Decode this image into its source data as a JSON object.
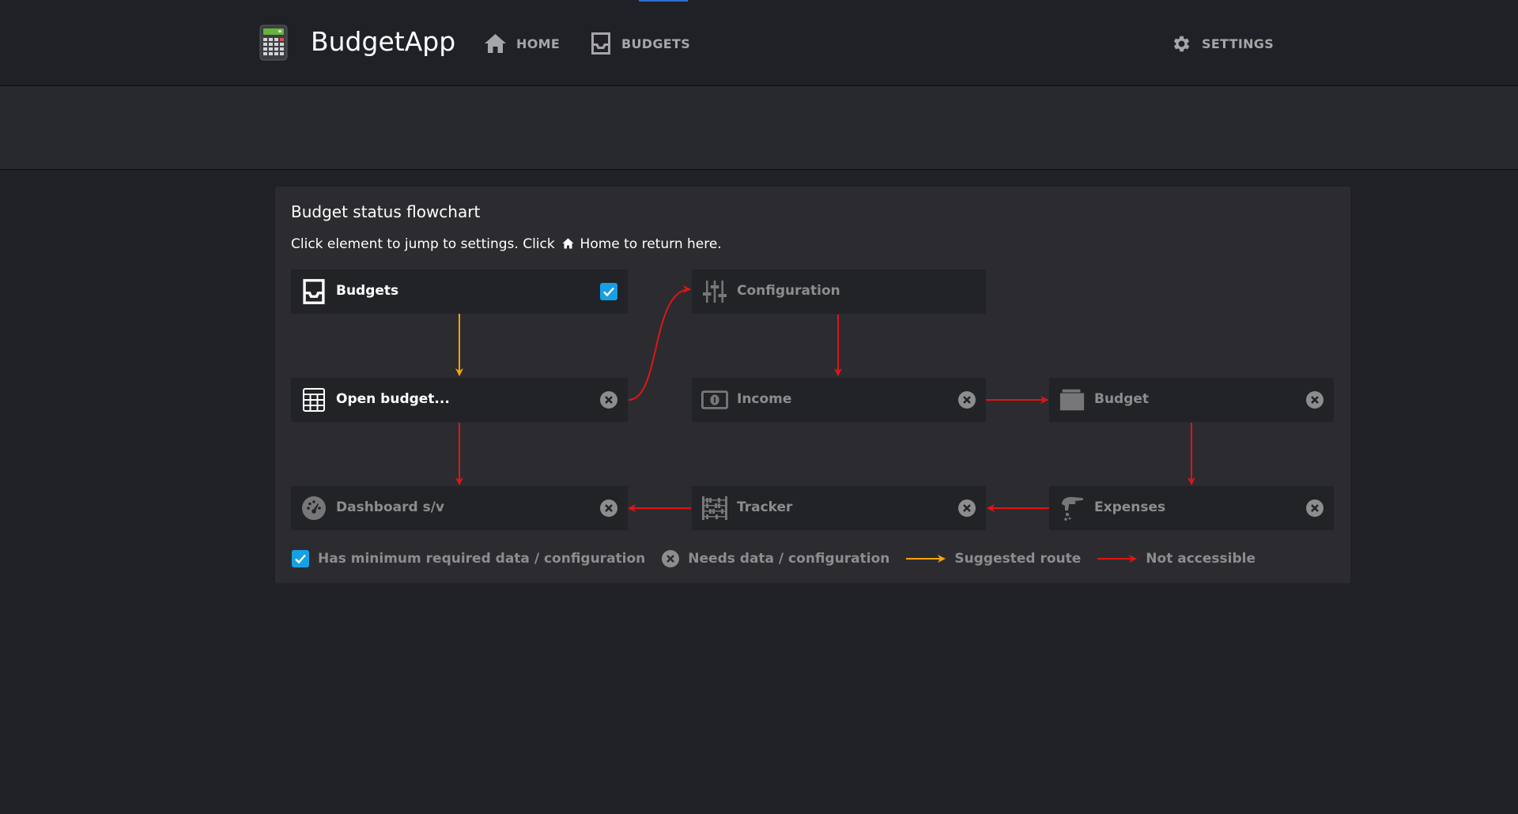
{
  "app": {
    "brand": "BudgetApp"
  },
  "nav": {
    "home": "HOME",
    "budgets": "BUDGETS",
    "settings": "SETTINGS"
  },
  "panel": {
    "title": "Budget status flowchart",
    "subtitle_prefix": "Click element to jump to settings. Click",
    "subtitle_suffix": "Home to return here."
  },
  "nodes": {
    "budgets": {
      "label": "Budgets",
      "icon": "inbox-icon",
      "status": "ok"
    },
    "open_budget": {
      "label": "Open budget...",
      "icon": "table-icon",
      "status": "needs"
    },
    "configuration": {
      "label": "Configuration",
      "icon": "sliders-icon",
      "status": "none"
    },
    "income": {
      "label": "Income",
      "icon": "money-icon",
      "status": "needs"
    },
    "budget": {
      "label": "Budget",
      "icon": "wallet-icon",
      "status": "needs"
    },
    "dashboard": {
      "label": "Dashboard s/v",
      "icon": "gauge-icon",
      "status": "needs"
    },
    "tracker": {
      "label": "Tracker",
      "icon": "abacus-icon",
      "status": "needs"
    },
    "expenses": {
      "label": "Expenses",
      "icon": "hand-coin-icon",
      "status": "needs"
    }
  },
  "legend": {
    "ok": "Has minimum required data / configuration",
    "needs": "Needs data / configuration",
    "suggested": "Suggested route",
    "not_accessible": "Not accessible"
  },
  "colors": {
    "background": "#202126",
    "panel": "#2c2c30",
    "node": "#222326",
    "check": "#16a0e4",
    "suggested_arrow": "#f5a30e",
    "blocked_arrow": "#e01515",
    "muted_text": "#8d8d90"
  }
}
